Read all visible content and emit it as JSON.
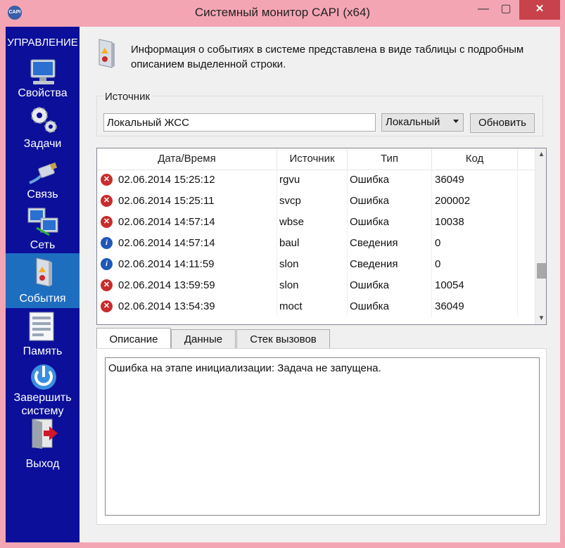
{
  "window": {
    "app_icon_text": "CAPI",
    "title": "Системный монитор CAPI (x64)",
    "min_glyph": "—",
    "max_glyph": "▢",
    "close_glyph": "✕"
  },
  "sidebar": {
    "heading": "УПРАВЛЕНИЕ",
    "items": [
      {
        "label": "Свойства",
        "icon": "computer-icon"
      },
      {
        "label": "Задачи",
        "icon": "gears-icon"
      },
      {
        "label": "Связь",
        "icon": "network-cable-icon"
      },
      {
        "label": "Сеть",
        "icon": "network-computers-icon"
      },
      {
        "label": "События",
        "icon": "event-log-icon",
        "active": true
      },
      {
        "label": "Память",
        "icon": "memory-dump-icon"
      },
      {
        "label": "Завершить системy",
        "icon": "power-icon"
      },
      {
        "label": "Выход",
        "icon": "exit-door-icon"
      }
    ],
    "active_color": "#1e6ec0",
    "background_color": "#0b0f9a"
  },
  "header": {
    "info_text": "Информация о событиях в системе представлена в виде таблицы с подробным описанием выделенной строки."
  },
  "source": {
    "group_label": "Источник",
    "input_value": "Локальный ЖСС",
    "select_value": "Локальный",
    "refresh_label": "Обновить"
  },
  "table": {
    "columns": [
      "Дата/Время",
      "Источник",
      "Тип",
      "Код"
    ],
    "rows": [
      {
        "kind": "error",
        "datetime": "02.06.2014 15:25:12",
        "source": "rgvu",
        "type": "Ошибка",
        "code": "36049"
      },
      {
        "kind": "error",
        "datetime": "02.06.2014 15:25:11",
        "source": "svcp",
        "type": "Ошибка",
        "code": "200002"
      },
      {
        "kind": "error",
        "datetime": "02.06.2014 14:57:14",
        "source": "wbse",
        "type": "Ошибка",
        "code": "10038"
      },
      {
        "kind": "info",
        "datetime": "02.06.2014 14:57:14",
        "source": "baul",
        "type": "Сведения",
        "code": "0"
      },
      {
        "kind": "info",
        "datetime": "02.06.2014 14:11:59",
        "source": "slon",
        "type": "Сведения",
        "code": "0"
      },
      {
        "kind": "error",
        "datetime": "02.06.2014 13:59:59",
        "source": "slon",
        "type": "Ошибка",
        "code": "10054"
      },
      {
        "kind": "error",
        "datetime": "02.06.2014 13:54:39",
        "source": "moct",
        "type": "Ошибка",
        "code": "36049"
      }
    ],
    "error_color": "#c92c2c",
    "info_color": "#2056b8"
  },
  "tabs": {
    "items": [
      "Описание",
      "Данные",
      "Стек вызовов"
    ],
    "active_index": 0
  },
  "description": {
    "text": "Ошибка на этапе инициализации: Задача не запущена."
  }
}
